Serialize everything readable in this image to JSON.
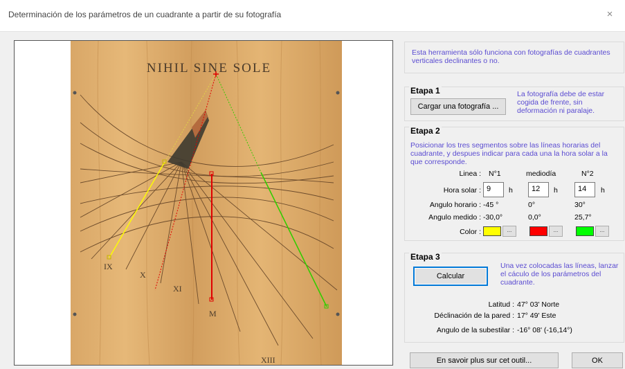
{
  "window": {
    "title": "Determinación de los parámetros de un cuadrante a partir de su fotografía",
    "close_glyph": "×"
  },
  "photo": {
    "motto": "NIHIL SINE SOLE",
    "hour_labels": [
      "IX",
      "X",
      "XI",
      "M",
      "XIII"
    ],
    "line_colors": {
      "line1": "#ffff00",
      "noon": "#e00000",
      "line2": "#33cc00"
    }
  },
  "intro": {
    "text": "Esta herramienta sólo funciona con fotografías de cuadrantes verticales declinantes o no."
  },
  "stage1": {
    "title": "Etapa 1",
    "load_button": "Cargar una fotografía ...",
    "note": "La fotografía debe de estar cogida de frente, sin deformación ni paralaje."
  },
  "stage2": {
    "title": "Etapa 2",
    "note": "Posicionar los tres segmentos sobre las líneas horarias del cuadrante, y despues indicar para cada una la hora solar a la que corresponde.",
    "line_label": "Linea :",
    "col_headers": [
      "N°1",
      "mediodía",
      "N°2"
    ],
    "solar_hour_label": "Hora solar :",
    "hours": [
      "9",
      "12",
      "14"
    ],
    "hour_unit": "h",
    "hour_angle_label": "Angulo horario :",
    "hour_angles": [
      "-45 °",
      "0°",
      "30°"
    ],
    "measured_angle_label": "Angulo medido :",
    "measured_angles": [
      "-30,0°",
      "0,0°",
      "25,7°"
    ],
    "color_label": "Color :",
    "colors": [
      "#ffff00",
      "#ff0000",
      "#00ff00"
    ],
    "color_button": "..."
  },
  "stage3": {
    "title": "Etapa 3",
    "calc_button": "Calcular",
    "note": "Una vez colocadas las líneas, lanzar el cáculo de los parámetros del cuadrante.",
    "results": [
      {
        "label": "Latitud :",
        "value": "47° 03' Norte"
      },
      {
        "label": "Déclinación de la pared :",
        "value": "17° 49' Este"
      },
      {
        "label": "Angulo de la subestilar :",
        "value": "-16° 08' (-16,14°)"
      }
    ]
  },
  "footer": {
    "more_button": "En savoir plus sur cet outil...",
    "ok_button": "OK"
  }
}
